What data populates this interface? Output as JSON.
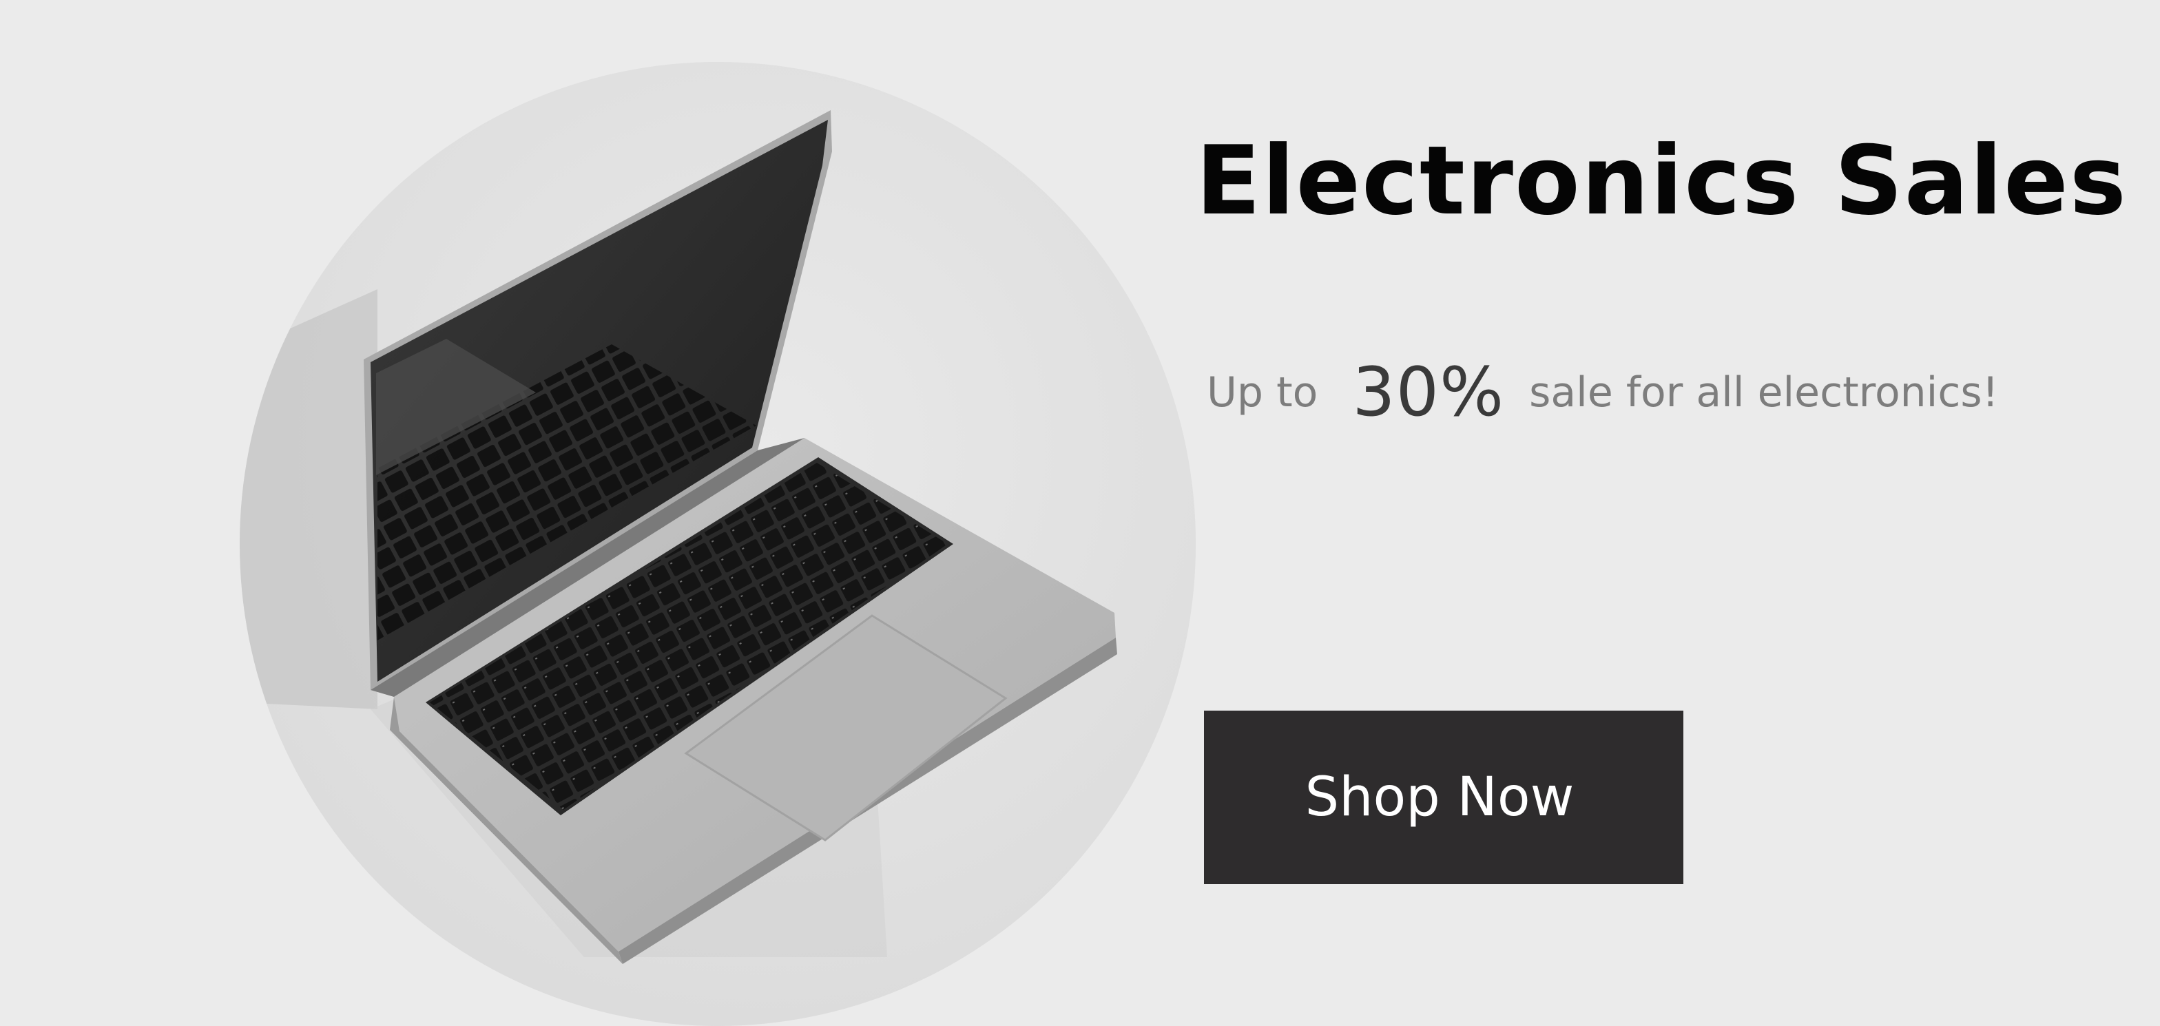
{
  "promo": {
    "headline": "Electronics Sales",
    "subline": {
      "prefix": "Up to",
      "percent": "30%",
      "suffix": "sale for all electronics!"
    },
    "cta_label": "Shop Now"
  },
  "image": {
    "icon": "laptop-photo"
  },
  "colors": {
    "background": "#ebebeb",
    "circle": "#e0e0e0",
    "button": "#2e2c2d",
    "headline": "#050505",
    "subtext": "#7d7d7d"
  }
}
